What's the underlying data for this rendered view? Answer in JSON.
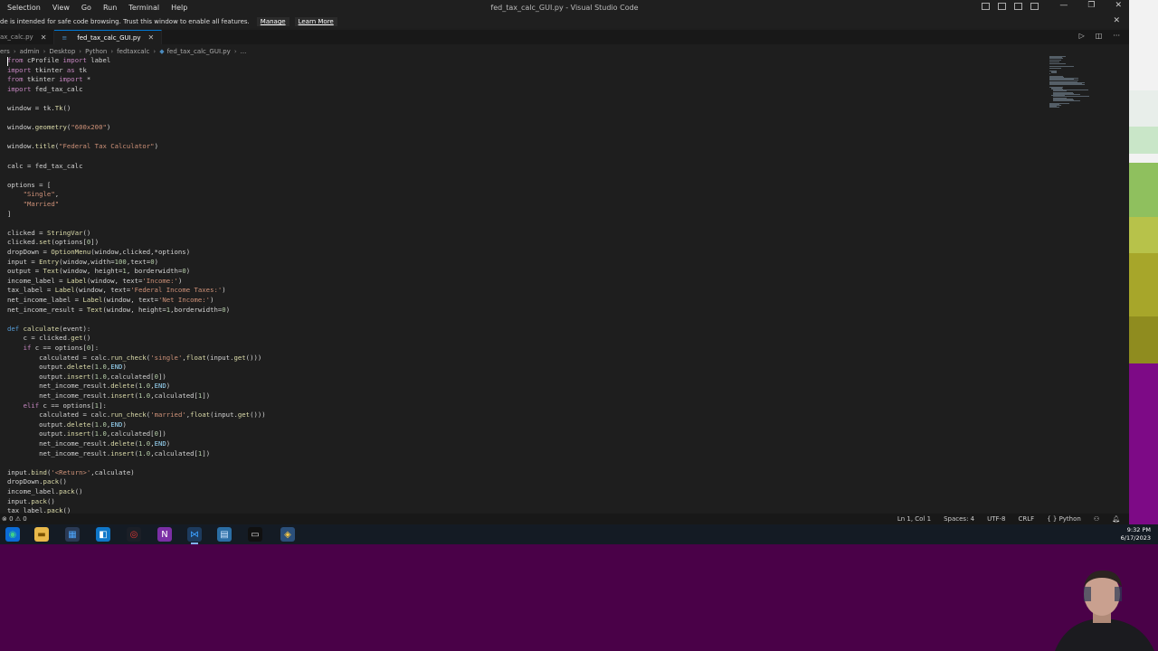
{
  "window": {
    "title": "fed_tax_calc_GUI.py - Visual Studio Code",
    "menu": [
      "Selection",
      "View",
      "Go",
      "Run",
      "Terminal",
      "Help"
    ]
  },
  "banner": {
    "text": "de is intended for safe code browsing. Trust this window to enable all features.",
    "manage": "Manage",
    "learn_more": "Learn More"
  },
  "tabs": [
    {
      "label": "ax_calc.py",
      "active": false
    },
    {
      "label": "fed_tax_calc_GUI.py",
      "active": true
    }
  ],
  "breadcrumb": [
    "ers",
    "admin",
    "Desktop",
    "Python",
    "fedtaxcalc",
    "fed_tax_calc_GUI.py",
    "..."
  ],
  "code": [
    "from cProfile import label",
    "import tkinter as tk",
    "from tkinter import *",
    "import fed_tax_calc",
    "",
    "window = tk.Tk()",
    "",
    "window.geometry(\"600x200\")",
    "",
    "window.title(\"Federal Tax Calculator\")",
    "",
    "calc = fed_tax_calc",
    "",
    "options = [",
    "    \"Single\",",
    "    \"Married\"",
    "]",
    "",
    "clicked = StringVar()",
    "clicked.set(options[0])",
    "dropDown = OptionMenu(window,clicked,*options)",
    "input = Entry(window,width=100,text=0)",
    "output = Text(window, height=1, borderwidth=0)",
    "income_label = Label(window, text='Income:')",
    "tax_label = Label(window, text='Federal Income Taxes:')",
    "net_income_label = Label(window, text='Net Income:')",
    "net_income_result = Text(window, height=1,borderwidth=0)",
    "",
    "def calculate(event):",
    "    c = clicked.get()",
    "    if c == options[0]:",
    "        calculated = calc.run_check('single',float(input.get()))",
    "        output.delete(1.0,END)",
    "        output.insert(1.0,calculated[0])",
    "        net_income_result.delete(1.0,END)",
    "        net_income_result.insert(1.0,calculated[1])",
    "    elif c == options[1]:",
    "        calculated = calc.run_check('married',float(input.get()))",
    "        output.delete(1.0,END)",
    "        output.insert(1.0,calculated[0])",
    "        net_income_result.delete(1.0,END)",
    "        net_income_result.insert(1.0,calculated[1])",
    "",
    "input.bind('<Return>',calculate)",
    "dropDown.pack()",
    "income_label.pack()",
    "input.pack()",
    "tax_label.pack()"
  ],
  "status": {
    "left": "⊗ 0 ⚠ 0",
    "position": "Ln 1, Col 1",
    "spaces": "Spaces: 4",
    "encoding": "UTF-8",
    "eol": "CRLF",
    "language": "Python"
  },
  "taskbar": {
    "icons": [
      "edge-icon",
      "file-explorer-icon",
      "store-icon",
      "chrome-icon",
      "onenote-icon",
      "vscode-icon",
      "notepad-icon",
      "terminal-icon",
      "python-icon"
    ],
    "time": "9:32 PM",
    "date": "6/17/2023"
  },
  "colors": {
    "background": "#4a0148",
    "editor": "#1e1e1e",
    "accent": "#0078d4"
  }
}
